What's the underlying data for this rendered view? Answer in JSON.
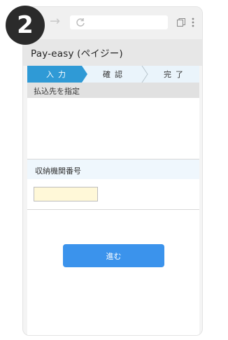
{
  "badge": {
    "number": "2"
  },
  "app": {
    "title": "Pay-easy (ペイジー)"
  },
  "steps": [
    {
      "label": "入力",
      "active": true
    },
    {
      "label": "確認",
      "active": false
    },
    {
      "label": "完了",
      "active": false
    }
  ],
  "section": {
    "title": "払込先を指定"
  },
  "field": {
    "label": "収納機関番号",
    "value": ""
  },
  "actions": {
    "next_label": "進む"
  },
  "colors": {
    "accent": "#3b93ec",
    "active_step": "#2f9ad6",
    "inactive_step": "#eaf4fb",
    "input_bg": "#fff8d8"
  }
}
